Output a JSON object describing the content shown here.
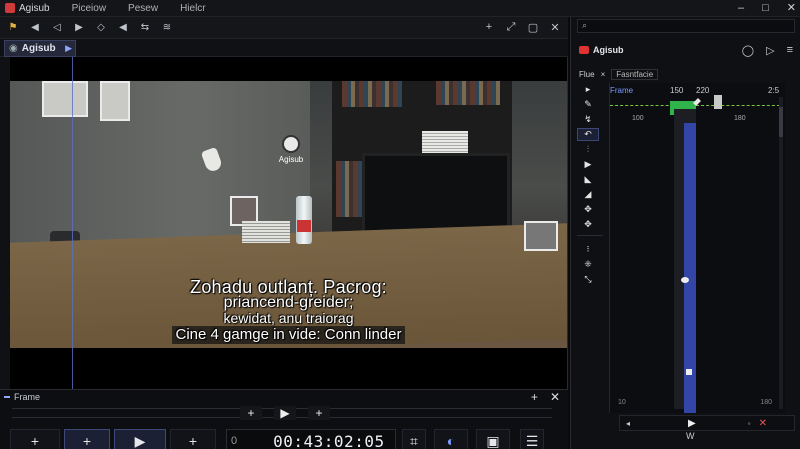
{
  "app": {
    "name": "Agisub"
  },
  "menu": [
    "Piceiow",
    "Pesew",
    "Hielcr"
  ],
  "window_controls": {
    "minimize": "–",
    "maximize": "□",
    "close": "✕"
  },
  "toolbar": {
    "icons": [
      "logo-icon",
      "back-icon",
      "forward-icon",
      "audio-icon",
      "volume-icon",
      "swap-icon",
      "layers-icon"
    ],
    "right_icons": [
      "add-icon",
      "expand-icon",
      "square-icon",
      "close-icon"
    ],
    "right_glyphs": [
      "+",
      "⤢",
      "▢",
      "✕"
    ]
  },
  "video_tab": {
    "label": "Agisub",
    "eye": "◉",
    "chevron": "▶"
  },
  "overlay": {
    "logo_text": "Agisub"
  },
  "subtitles": {
    "line1": "Zohadu outlanț. Pacrog:",
    "line2": "priancend-greider;",
    "line3": "kewidat, anu traiorag",
    "line4": "Cine 4 gamge in vide: Conn linder"
  },
  "frame_panel": {
    "title": "Frame",
    "track_buttons": [
      "+",
      "▶",
      "+"
    ],
    "controls": [
      "+",
      "+",
      "▶",
      "+"
    ],
    "timecode_prefix": "0",
    "timecode": "00:43:02:05",
    "right_icons": [
      "⌗",
      "◐",
      "▣",
      "☰"
    ]
  },
  "right_panel": {
    "search_glyph": "⌕",
    "app_label": "Agisub",
    "head_icons": [
      "◯",
      "▷",
      "≡"
    ],
    "tabs": {
      "file": "Flue",
      "file_x": "×",
      "tab2": "Fasntfacie"
    },
    "tools": [
      "▸",
      "✎",
      "↯",
      "↶",
      "⫶",
      "▶",
      "◣",
      "◢",
      "✥",
      "✥",
      "⁝",
      "⁜",
      "⤡"
    ],
    "header": {
      "frame_label": "Frame",
      "v1": "150",
      "v2": "220",
      "v3": "2:5"
    },
    "scale": {
      "left": "100",
      "right": "180"
    },
    "footer": {
      "left": "10",
      "right": "180"
    },
    "progress_fraction": 0.45,
    "ctrl_row": {
      "left": "◂",
      "play": "▶",
      "x1": "◦",
      "x2": "✕"
    },
    "footer_letter": "W"
  },
  "colors": {
    "accent": "#3346a8",
    "timeline_green": "#2fb34a",
    "logo_red": "#d33"
  }
}
